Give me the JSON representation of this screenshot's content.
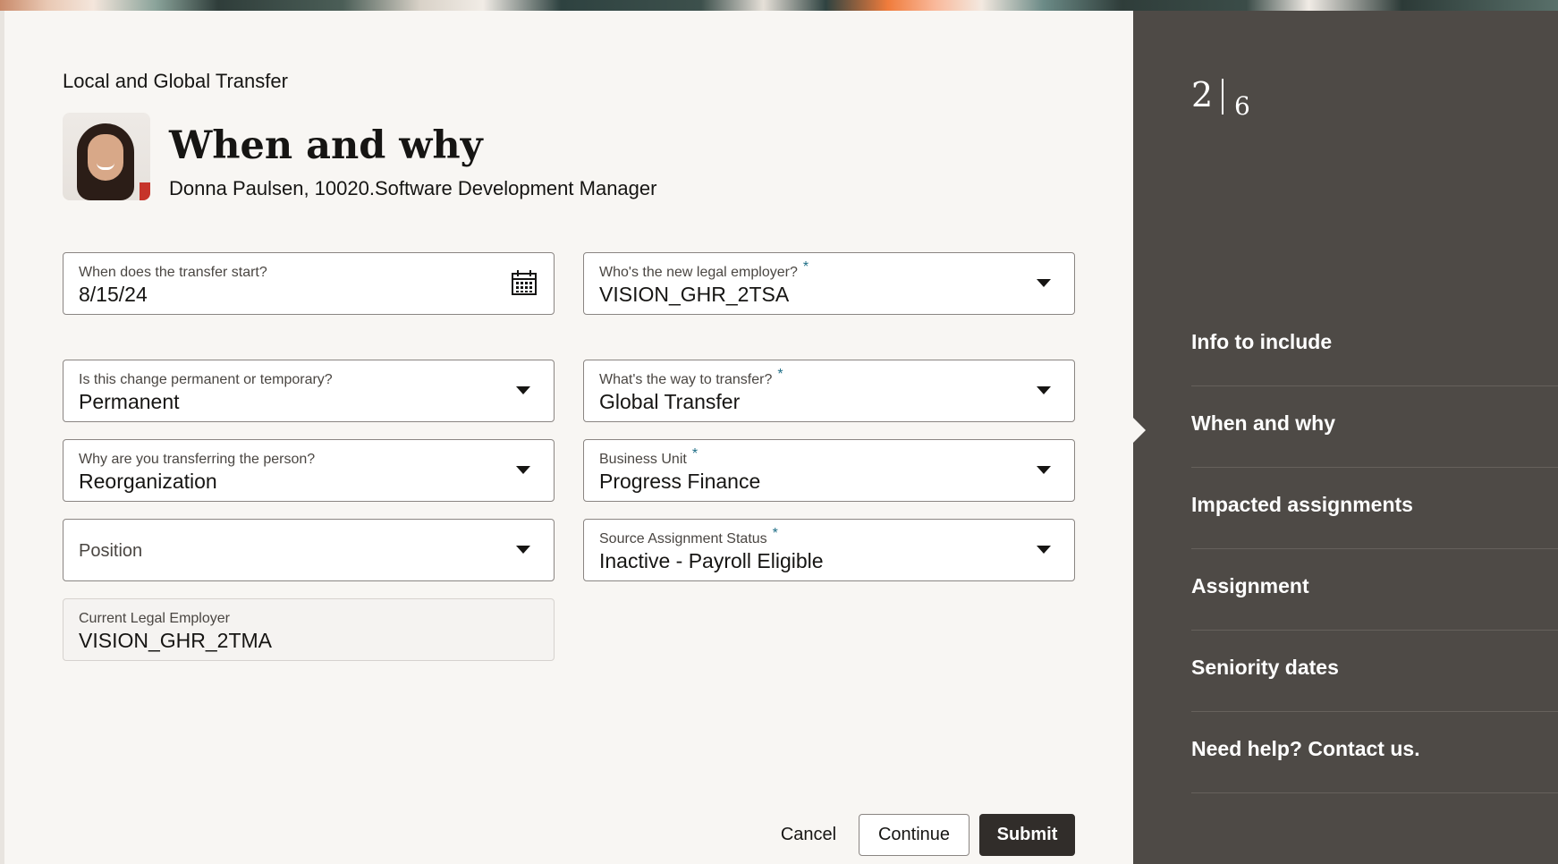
{
  "header": {
    "flow_title": "Local and Global Transfer",
    "page_title": "When and why",
    "person": "Donna Paulsen, 10020.Software Development Manager"
  },
  "fields": {
    "start_date": {
      "label": "When does the transfer start?",
      "value": "8/15/24"
    },
    "legal_employer": {
      "label": "Who's the new legal employer?",
      "value": "VISION_GHR_2TSA",
      "required": "*"
    },
    "change_type": {
      "label": "Is this change permanent or temporary?",
      "value": "Permanent"
    },
    "transfer_way": {
      "label": "What's the way to transfer?",
      "value": "Global Transfer",
      "required": "*"
    },
    "reason": {
      "label": "Why are you transferring the person?",
      "value": "Reorganization"
    },
    "business_unit": {
      "label": "Business Unit",
      "value": "Progress Finance",
      "required": "*"
    },
    "position": {
      "placeholder": "Position"
    },
    "source_status": {
      "label": "Source Assignment Status",
      "value": "Inactive - Payroll Eligible",
      "required": "*"
    },
    "current_employer": {
      "label": "Current Legal Employer",
      "value": "VISION_GHR_2TMA"
    }
  },
  "steps": {
    "current": "2",
    "total": "6",
    "items": [
      "Info to include",
      "When and why",
      "Impacted assignments",
      "Assignment",
      "Seniority dates",
      "Need help? Contact us."
    ]
  },
  "actions": {
    "cancel": "Cancel",
    "continue": "Continue",
    "submit": "Submit"
  },
  "icons": {
    "calendar": "calendar-icon",
    "dropdown": "chevron-down-icon"
  },
  "colors": {
    "rail": "#4e4a46",
    "primary_button": "#312d2a",
    "required_marker": "#1f6e86"
  }
}
